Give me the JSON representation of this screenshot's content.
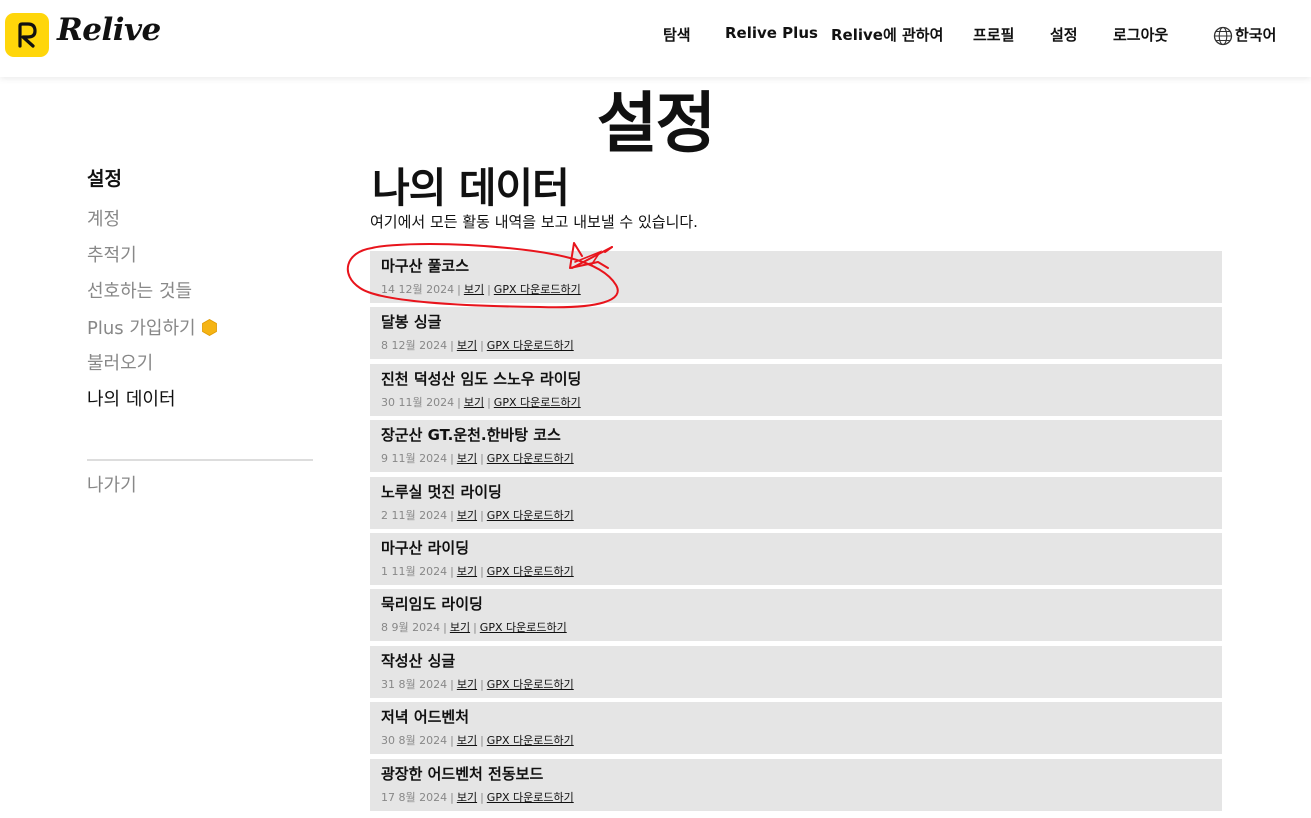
{
  "brand": {
    "name": "Relive",
    "accent": "#ffd60a"
  },
  "nav": {
    "explore": "탐색",
    "plus": "Relive Plus",
    "about": "Relive에 관하여",
    "profile": "프로필",
    "settings": "설정",
    "logout": "로그아웃",
    "language": "한국어",
    "language_icon": "globe-icon"
  },
  "page_title": "설정",
  "sidebar": {
    "heading": "설정",
    "items": [
      {
        "label": "계정"
      },
      {
        "label": "추적기"
      },
      {
        "label": "선호하는 것들"
      },
      {
        "label": "Plus 가입하기",
        "icon": "plus-badge-icon"
      },
      {
        "label": "불러오기"
      },
      {
        "label": "나의 데이터",
        "active": true
      }
    ],
    "exit": "나가기"
  },
  "main": {
    "title": "나의 데이터",
    "description": "여기에서 모든 활동 내역을 보고 내보낼 수 있습니다.",
    "view_label": "보기",
    "gpx_label": "GPX 다운로드하기",
    "activities": [
      {
        "title": "마구산 풀코스",
        "date": "14 12월 2024"
      },
      {
        "title": "달봉 싱글",
        "date": "8 12월 2024"
      },
      {
        "title": "진천 덕성산 임도 스노우 라이딩",
        "date": "30 11월 2024"
      },
      {
        "title": "장군산 GT.운천.한바탕 코스",
        "date": "9 11월 2024"
      },
      {
        "title": "노루실 멋진 라이딩",
        "date": "2 11월 2024"
      },
      {
        "title": "마구산 라이딩",
        "date": "1 11월 2024"
      },
      {
        "title": "묵리임도 라이딩",
        "date": "8 9월 2024"
      },
      {
        "title": "작성산 싱글",
        "date": "31 8월 2024"
      },
      {
        "title": "저녁 어드벤처",
        "date": "30 8월 2024"
      },
      {
        "title": "광장한 어드벤처 전동보드",
        "date": "17 8월 2024"
      }
    ]
  },
  "annotation": {
    "color": "#e8141c",
    "target": "마구산 풀코스"
  }
}
